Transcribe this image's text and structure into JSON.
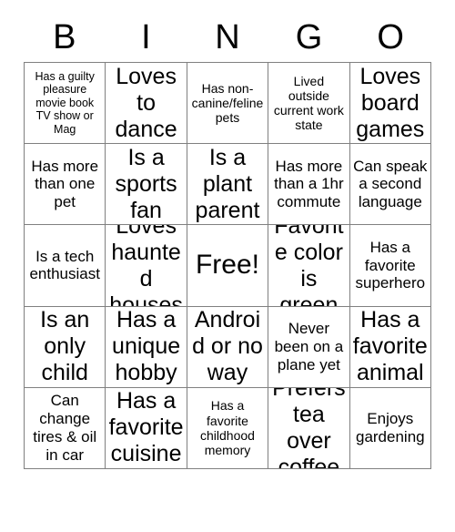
{
  "card": {
    "title": "BINGO",
    "header_letters": [
      "B",
      "I",
      "N",
      "G",
      "O"
    ],
    "columns": 5,
    "rows": 5,
    "free_space": {
      "row": 3,
      "column": 3,
      "label": "Free!"
    },
    "colors": {
      "background": "#ffffff",
      "text": "#000000",
      "grid_line": "#808080"
    },
    "squares": [
      [
        {
          "text": "Has a guilty pleasure movie book TV show or Mag",
          "size": "xs",
          "free": false
        },
        {
          "text": "Loves to dance",
          "size": "xl",
          "free": false
        },
        {
          "text": "Has non-canine/feline pets",
          "size": "sm",
          "free": false
        },
        {
          "text": "Lived outside current work state",
          "size": "sm",
          "free": false
        },
        {
          "text": "Loves board games",
          "size": "xl",
          "free": false
        }
      ],
      [
        {
          "text": "Has more than one pet",
          "size": "md",
          "free": false
        },
        {
          "text": "Is a sports fan",
          "size": "xl",
          "free": false
        },
        {
          "text": "Is a plant parent",
          "size": "xl",
          "free": false
        },
        {
          "text": "Has more than a 1hr commute",
          "size": "md",
          "free": false
        },
        {
          "text": "Can speak a second language",
          "size": "md",
          "free": false
        }
      ],
      [
        {
          "text": "Is a tech enthusiast",
          "size": "md",
          "free": false
        },
        {
          "text": "Loves haunted houses",
          "size": "xl",
          "free": false
        },
        {
          "text": "Free!",
          "size": "free",
          "free": true
        },
        {
          "text": "Favorite color is green",
          "size": "xl",
          "free": false
        },
        {
          "text": "Has a favorite superhero",
          "size": "md",
          "free": false
        }
      ],
      [
        {
          "text": "Is an only child",
          "size": "xl",
          "free": false
        },
        {
          "text": "Has a unique hobby",
          "size": "xl",
          "free": false
        },
        {
          "text": "Android or no way",
          "size": "xl",
          "free": false
        },
        {
          "text": "Never been on a plane yet",
          "size": "md",
          "free": false
        },
        {
          "text": "Has a favorite animal",
          "size": "xl",
          "free": false
        }
      ],
      [
        {
          "text": "Can change tires & oil in car",
          "size": "md",
          "free": false
        },
        {
          "text": "Has a favorite cuisine",
          "size": "xl",
          "free": false
        },
        {
          "text": "Has a favorite childhood memory",
          "size": "sm",
          "free": false
        },
        {
          "text": "Prefers tea over coffee",
          "size": "xl",
          "free": false
        },
        {
          "text": "Enjoys gardening",
          "size": "md",
          "free": false
        }
      ]
    ]
  }
}
